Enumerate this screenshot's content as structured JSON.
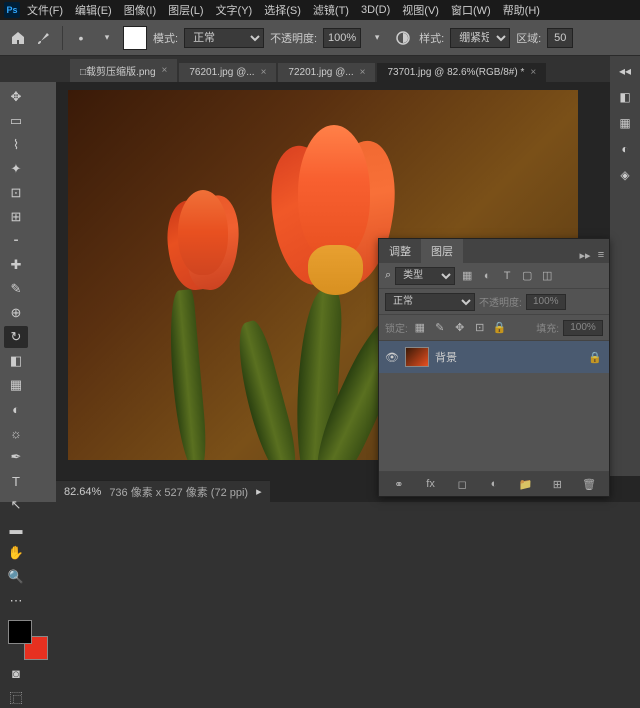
{
  "menu": [
    "文件(F)",
    "编辑(E)",
    "图像(I)",
    "图层(L)",
    "文字(Y)",
    "选择(S)",
    "滤镜(T)",
    "3D(D)",
    "视图(V)",
    "窗口(W)",
    "帮助(H)"
  ],
  "toolbar": {
    "mode_label": "模式:",
    "mode_value": "正常",
    "opacity_label": "不透明度:",
    "opacity_value": "100%",
    "style_label": "样式:",
    "style_value": "绷紧短",
    "area_label": "区域:",
    "area_value": "50"
  },
  "tabs": [
    {
      "label": "□载剪压缩版.png",
      "active": false
    },
    {
      "label": "76201.jpg @...",
      "active": false
    },
    {
      "label": "72201.jpg @...",
      "active": false
    },
    {
      "label": "73701.jpg @ 82.6%(RGB/8#) *",
      "active": true
    }
  ],
  "status": {
    "zoom": "82.64%",
    "info": "736 像素 x 527 像素 (72 ppi)"
  },
  "layers": {
    "tab1": "调整",
    "tab2": "图层",
    "kind": "类型",
    "blend": "正常",
    "opacity_label": "不透明度:",
    "opacity": "100%",
    "lock_label": "锁定:",
    "fill_label": "填充:",
    "fill": "100%",
    "items": [
      {
        "name": "背景",
        "locked": true
      }
    ]
  },
  "colors": {
    "fg": "#000000",
    "bg": "#e73020"
  }
}
